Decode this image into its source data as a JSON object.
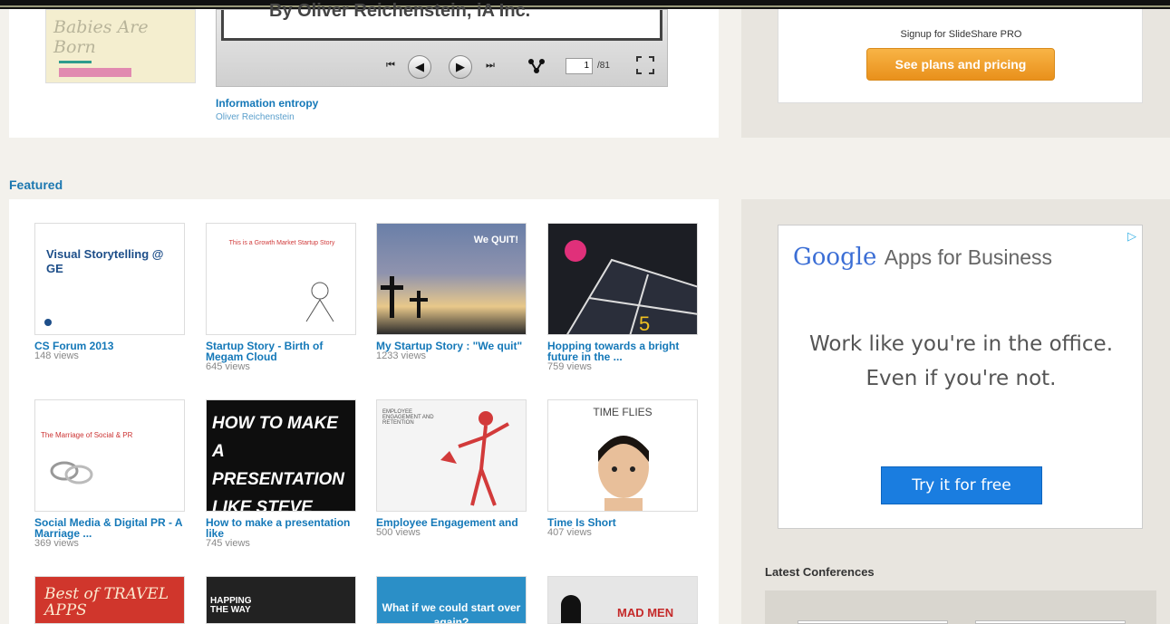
{
  "top_player": {
    "slide_caption": "By Oliver Reichenstein, iA Inc.",
    "thumb_text": "Babies Are Born",
    "title": "Information entropy",
    "author": "Oliver Reichenstein",
    "controls": {
      "first": "⏮",
      "prev": "◀",
      "next": "▶",
      "last": "⏭",
      "page_current": "1",
      "page_total": "/81"
    }
  },
  "pro_box": {
    "signup_text": "Signup for SlideShare PRO",
    "button_label": "See plans and pricing"
  },
  "featured": {
    "heading": "Featured",
    "items": [
      {
        "title": "CS Forum 2013",
        "views": "148 views",
        "thumb_text": "Visual Storytelling @ GE"
      },
      {
        "title": "Startup Story - Birth of Megam Cloud",
        "views": "645 views",
        "thumb_text": "This is a Growth Market Startup Story"
      },
      {
        "title": "My Startup Story : \"We quit\"",
        "views": "1233 views",
        "thumb_text": "We QUIT!"
      },
      {
        "title": "Hopping towards a bright future in the ...",
        "views": "759 views",
        "thumb_text": ""
      },
      {
        "title": "Social Media & Digital PR - A Marriage ...",
        "views": "369 views",
        "thumb_text": "The Marriage of Social & PR"
      },
      {
        "title": "How to make a presentation like",
        "views": "745 views",
        "thumb_text": "HOW TO MAKE A PRESENTATION LIKE STEVE JOBS"
      },
      {
        "title": "Employee Engagement and",
        "views": "500 views",
        "thumb_text": "EMPLOYEE ENGAGEMENT AND RETENTION"
      },
      {
        "title": "Time Is Short",
        "views": "407 views",
        "thumb_text": "TIME FLIES"
      },
      {
        "title": "",
        "views": "",
        "thumb_text": "Best of TRAVEL APPS"
      },
      {
        "title": "",
        "views": "",
        "thumb_text": "HAPPING THE WAY"
      },
      {
        "title": "",
        "views": "",
        "thumb_text": "What if we could start over again?"
      },
      {
        "title": "",
        "views": "",
        "thumb_text": "MAD MEN"
      }
    ]
  },
  "ad": {
    "logo_google": "Google",
    "logo_apps": "Apps for Business",
    "line1": "Work like you're in the office.",
    "line2": "Even if you're not.",
    "button_label": "Try it for free",
    "choice_icon": "adchoices-icon"
  },
  "sidebar": {
    "conferences_heading": "Latest Conferences"
  },
  "colors": {
    "link_blue": "#1478b8",
    "orange_button": "#f0a030",
    "ad_button_blue": "#1a7de0"
  }
}
